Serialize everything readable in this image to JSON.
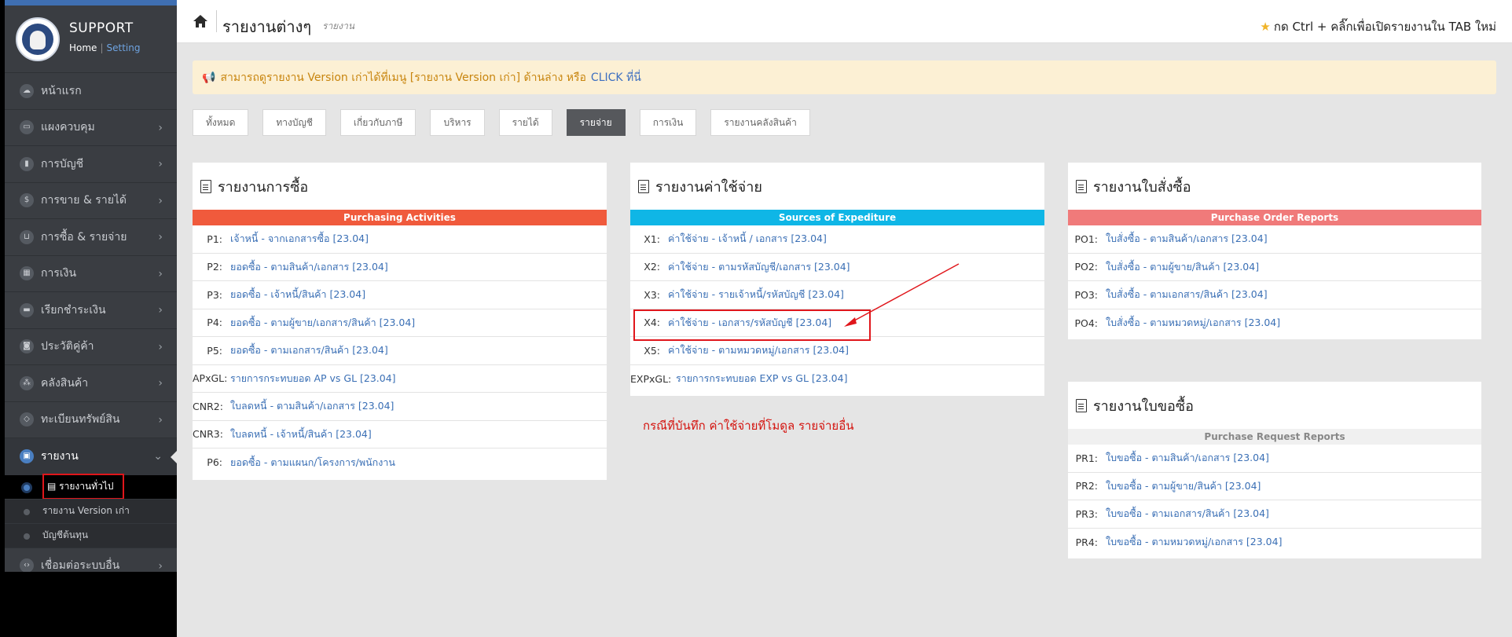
{
  "sidebar": {
    "brand_name": "SUPPORT",
    "home_link": "Home",
    "separator": "|",
    "setting_link": "Setting",
    "items": [
      {
        "label": "หน้าแรก",
        "icon": "cloud-icon",
        "glyph": "☁"
      },
      {
        "label": "แผงควบคุม",
        "icon": "monitor-icon",
        "glyph": "▭"
      },
      {
        "label": "การบัญชี",
        "icon": "book-icon",
        "glyph": "▮"
      },
      {
        "label": "การขาย & รายได้",
        "icon": "dollar-icon",
        "glyph": "$"
      },
      {
        "label": "การซื้อ & รายจ่าย",
        "icon": "cart-icon",
        "glyph": "⊔"
      },
      {
        "label": "การเงิน",
        "icon": "calendar-icon",
        "glyph": "▦"
      },
      {
        "label": "เรียกชำระเงิน",
        "icon": "card-icon",
        "glyph": "▬"
      },
      {
        "label": "ประวัติคู่ค้า",
        "icon": "contact-icon",
        "glyph": "◙"
      },
      {
        "label": "คลังสินค้า",
        "icon": "boxes-icon",
        "glyph": "⁂"
      },
      {
        "label": "ทะเบียนทรัพย์สิน",
        "icon": "diamond-icon",
        "glyph": "◇"
      },
      {
        "label": "รายงาน",
        "icon": "report-icon",
        "glyph": "▣"
      }
    ],
    "sub_items": [
      {
        "label": "รายงานทั่วไป"
      },
      {
        "label": "รายงาน Version เก่า"
      },
      {
        "label": "บัญชีต้นทุน"
      }
    ],
    "last_item": {
      "label": "เชื่อมต่อระบบอื่น",
      "icon": "code-icon",
      "glyph": "‹›"
    }
  },
  "header": {
    "title": "รายงานต่างๆ",
    "subtitle": "รายงาน",
    "hint": "กด Ctrl + คลิ๊กเพื่อเปิดรายงานใน TAB ใหม่"
  },
  "notice": {
    "text": "สามารถดูรายงาน Version เก่าได้ที่เมนู [รายงาน Version เก่า] ด้านล่าง หรือ",
    "link": "CLICK ที่นี่"
  },
  "tabs": [
    "ทั้งหมด",
    "ทางบัญชี",
    "เกี่ยวกับภาษี",
    "บริหาร",
    "รายได้",
    "รายจ่าย",
    "การเงิน",
    "รายงานคลังสินค้า"
  ],
  "active_tab": "รายจ่าย",
  "panels": {
    "purchase": {
      "title": "รายงานการซื้อ",
      "band": "Purchasing Activities",
      "band_color": "#f05a3c",
      "rows": [
        {
          "code": "P1:",
          "label": "เจ้าหนี้ - จากเอกสารซื้อ [23.04]"
        },
        {
          "code": "P2:",
          "label": "ยอดซื้อ - ตามสินค้า/เอกสาร [23.04]"
        },
        {
          "code": "P3:",
          "label": "ยอดซื้อ - เจ้าหนี้/สินค้า [23.04]"
        },
        {
          "code": "P4:",
          "label": "ยอดซื้อ - ตามผู้ขาย/เอกสาร/สินค้า [23.04]"
        },
        {
          "code": "P5:",
          "label": "ยอดซื้อ - ตามเอกสาร/สินค้า [23.04]"
        },
        {
          "code": "APxGL:",
          "label": "รายการกระทบยอด AP vs GL [23.04]"
        },
        {
          "code": "CNR2:",
          "label": "ใบลดหนี้ - ตามสินค้า/เอกสาร [23.04]"
        },
        {
          "code": "CNR3:",
          "label": "ใบลดหนี้ - เจ้าหนี้/สินค้า [23.04]"
        },
        {
          "code": "P6:",
          "label": "ยอดซื้อ - ตามแผนก/โครงการ/พนักงาน"
        }
      ]
    },
    "expense": {
      "title": "รายงานค่าใช้จ่าย",
      "band": "Sources of Expediture",
      "band_color": "#0fb6e6",
      "rows": [
        {
          "code": "X1:",
          "label": "ค่าใช้จ่าย - เจ้าหนี้ / เอกสาร [23.04]"
        },
        {
          "code": "X2:",
          "label": "ค่าใช้จ่าย - ตามรหัสบัญชี/เอกสาร [23.04]"
        },
        {
          "code": "X3:",
          "label": "ค่าใช้จ่าย - รายเจ้าหนี้/รหัสบัญชี [23.04]"
        },
        {
          "code": "X4:",
          "label": "ค่าใช้จ่าย - เอกสาร/รหัสบัญชี [23.04]"
        },
        {
          "code": "X5:",
          "label": "ค่าใช้จ่าย - ตามหมวดหมู่/เอกสาร [23.04]"
        },
        {
          "code": "EXPxGL:",
          "label": "รายการกระทบยอด EXP vs GL [23.04]"
        }
      ],
      "annotation": "กรณีที่บันทึก ค่าใช้จ่ายที่โมดูล รายจ่ายอื่น"
    },
    "po": {
      "title": "รายงานใบสั่งซื้อ",
      "band": "Purchase Order Reports",
      "band_color": "#f07a7a",
      "rows": [
        {
          "code": "PO1:",
          "label": "ใบสั่งซื้อ - ตามสินค้า/เอกสาร [23.04]"
        },
        {
          "code": "PO2:",
          "label": "ใบสั่งซื้อ - ตามผู้ขาย/สินค้า [23.04]"
        },
        {
          "code": "PO3:",
          "label": "ใบสั่งซื้อ - ตามเอกสาร/สินค้า [23.04]"
        },
        {
          "code": "PO4:",
          "label": "ใบสั่งซื้อ - ตามหมวดหมู่/เอกสาร [23.04]"
        }
      ]
    },
    "pr": {
      "title": "รายงานใบขอซื้อ",
      "band": "Purchase Request Reports",
      "band_color": "#f0f0f0",
      "rows": [
        {
          "code": "PR1:",
          "label": "ใบขอซื้อ - ตามสินค้า/เอกสาร [23.04]"
        },
        {
          "code": "PR2:",
          "label": "ใบขอซื้อ - ตามผู้ขาย/สินค้า [23.04]"
        },
        {
          "code": "PR3:",
          "label": "ใบขอซื้อ - ตามเอกสาร/สินค้า [23.04]"
        },
        {
          "code": "PR4:",
          "label": "ใบขอซื้อ - ตามหมวดหมู่/เอกสาร [23.04]"
        }
      ]
    }
  }
}
